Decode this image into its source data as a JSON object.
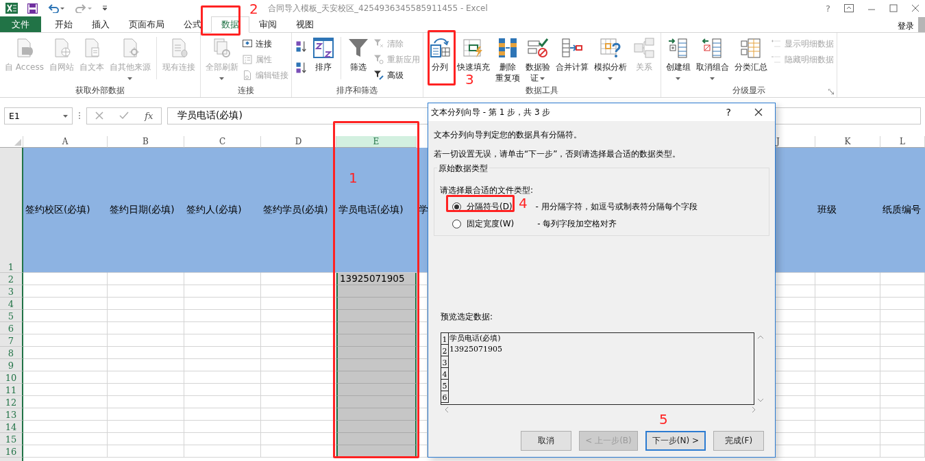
{
  "window": {
    "title": "合同导入模板_天安校区_4254936345585911455 - Excel",
    "help": "?",
    "signin": "登录"
  },
  "menu_tabs": [
    {
      "label": "文件",
      "kind": "file",
      "selected": false
    },
    {
      "label": "开始",
      "kind": "tab",
      "selected": false
    },
    {
      "label": "插入",
      "kind": "tab",
      "selected": false
    },
    {
      "label": "页面布局",
      "kind": "tab",
      "selected": false
    },
    {
      "label": "公式",
      "kind": "tab",
      "selected": false
    },
    {
      "label": "数据",
      "kind": "tab",
      "selected": true
    },
    {
      "label": "审阅",
      "kind": "tab",
      "selected": false
    },
    {
      "label": "视图",
      "kind": "tab",
      "selected": false
    }
  ],
  "ribbon": {
    "groups": [
      {
        "title": "获取外部数据",
        "launcher": false,
        "items": [
          {
            "kind": "large",
            "lines": [
              "自 Access"
            ],
            "disabled": true,
            "dropdown": false
          },
          {
            "kind": "large",
            "lines": [
              "自网站"
            ],
            "disabled": true,
            "dropdown": false
          },
          {
            "kind": "large",
            "lines": [
              "自文本"
            ],
            "disabled": true,
            "dropdown": false
          },
          {
            "kind": "large",
            "lines": [
              "自其他来源"
            ],
            "disabled": true,
            "dropdown": true
          },
          {
            "kind": "separator"
          },
          {
            "kind": "large",
            "lines": [
              "现有连接"
            ],
            "disabled": true,
            "dropdown": false
          }
        ]
      },
      {
        "title": "连接",
        "launcher": false,
        "items": [
          {
            "kind": "large",
            "lines": [
              "全部刷新"
            ],
            "disabled": true,
            "dropdown": true
          },
          {
            "kind": "stack",
            "items": [
              {
                "label": "连接",
                "disabled": false
              },
              {
                "label": "属性",
                "disabled": true
              },
              {
                "label": "编辑链接",
                "disabled": true
              }
            ]
          }
        ]
      },
      {
        "title": "排序和筛选",
        "launcher": false,
        "items": [
          {
            "kind": "stack",
            "items": [
              {
                "disabled": false
              },
              {
                "disabled": false
              }
            ]
          },
          {
            "kind": "large",
            "lines": [
              "排序"
            ],
            "disabled": false,
            "dropdown": false
          },
          {
            "kind": "separator"
          },
          {
            "kind": "large",
            "lines": [
              "筛选"
            ],
            "disabled": false,
            "dropdown": false
          },
          {
            "kind": "stack",
            "items": [
              {
                "label": "清除",
                "disabled": true
              },
              {
                "label": "重新应用",
                "disabled": true
              },
              {
                "label": "高级",
                "disabled": false
              }
            ]
          }
        ]
      },
      {
        "title": "数据工具",
        "launcher": false,
        "items": [
          {
            "kind": "large",
            "lines": [
              "分列"
            ],
            "disabled": false,
            "dropdown": false
          },
          {
            "kind": "large",
            "lines": [
              "快速填充"
            ],
            "disabled": false,
            "dropdown": false
          },
          {
            "kind": "large",
            "lines": [
              "删除",
              "重复项"
            ],
            "disabled": false,
            "dropdown": false
          },
          {
            "kind": "large",
            "lines": [
              "数据验",
              "证"
            ],
            "disabled": false,
            "dropdown": true
          },
          {
            "kind": "large",
            "lines": [
              "合并计算"
            ],
            "disabled": false,
            "dropdown": false
          },
          {
            "kind": "large",
            "lines": [
              "模拟分析"
            ],
            "disabled": false,
            "dropdown": true
          },
          {
            "kind": "large",
            "lines": [
              "关系"
            ],
            "disabled": true,
            "dropdown": false
          }
        ]
      },
      {
        "title": "分级显示",
        "launcher": true,
        "items": [
          {
            "kind": "large",
            "lines": [
              "创建组"
            ],
            "disabled": false,
            "dropdown": true
          },
          {
            "kind": "large",
            "lines": [
              "取消组合"
            ],
            "disabled": false,
            "dropdown": true
          },
          {
            "kind": "large",
            "lines": [
              "分类汇总"
            ],
            "disabled": false,
            "dropdown": false
          },
          {
            "kind": "stack",
            "items": [
              {
                "label": "显示明细数据",
                "disabled": true
              },
              {
                "label": "隐藏明细数据",
                "disabled": true
              }
            ]
          }
        ]
      }
    ]
  },
  "formula_bar": {
    "name_box": "E1",
    "function_label": "fx",
    "content": "学员电话(必填)"
  },
  "sheet": {
    "columns_left": [
      {
        "letter": "A",
        "header": "签约校区(必填)",
        "selected": false
      },
      {
        "letter": "B",
        "header": "签约日期(必填)",
        "selected": false
      },
      {
        "letter": "C",
        "header": "签约人(必填)",
        "selected": false
      },
      {
        "letter": "D",
        "header": "签约学员(必填)",
        "selected": false
      },
      {
        "letter": "E",
        "header": "学员电话(必填)",
        "selected": true,
        "cells": [
          "13925071905"
        ]
      },
      {
        "header": "学",
        "selected": false
      }
    ],
    "columns_right": [
      {
        "letter": "J",
        "selected": false
      },
      {
        "letter": "K",
        "header": "班级",
        "selected": false
      },
      {
        "letter": "L",
        "header": "纸质编号",
        "selected": false
      }
    ],
    "row_labels": [
      "1",
      "2",
      "3",
      "4",
      "5",
      "6",
      "7",
      "8",
      "9",
      "10",
      "11",
      "12",
      "13",
      "14",
      "15",
      "16"
    ]
  },
  "dialog": {
    "title": "文本分列向导 - 第 1 步，共 3 步",
    "help": "?",
    "intro": "文本分列向导判定您的数据具有分隔符。",
    "hint": "若一切设置无误，请单击“下一步”，否则请选择最合适的数据类型。",
    "group_title": "原始数据类型",
    "prompt": "请选择最合适的文件类型:",
    "options": [
      {
        "label": "分隔符号(D)",
        "description": "- 用分隔字符，如逗号或制表符分隔每个字段",
        "selected": true
      },
      {
        "label": "固定宽度(W)",
        "description": "- 每列字段加空格对齐",
        "selected": false
      }
    ],
    "preview_label": "预览选定数据:",
    "preview_rows": [
      {
        "number": "1",
        "text": "学员电话(必填)"
      },
      {
        "number": "2",
        "text": "13925071905"
      },
      {
        "number": "3"
      },
      {
        "number": "4"
      },
      {
        "number": "5"
      },
      {
        "number": "6"
      }
    ],
    "buttons": [
      {
        "label": "取消",
        "disabled": false,
        "default": false
      },
      {
        "label": "< 上一步(B)",
        "disabled": true,
        "default": false
      },
      {
        "label": "下一步(N) >",
        "disabled": false,
        "default": true
      },
      {
        "label": "完成(F)",
        "disabled": false,
        "default": false
      }
    ]
  },
  "annotations": [
    {
      "number": "1",
      "kind": "boxed"
    },
    {
      "number": "2",
      "kind": "boxed"
    },
    {
      "number": "3",
      "kind": "boxed"
    },
    {
      "number": "4",
      "kind": "boxed"
    },
    {
      "number": "5",
      "kind": "plain"
    }
  ]
}
